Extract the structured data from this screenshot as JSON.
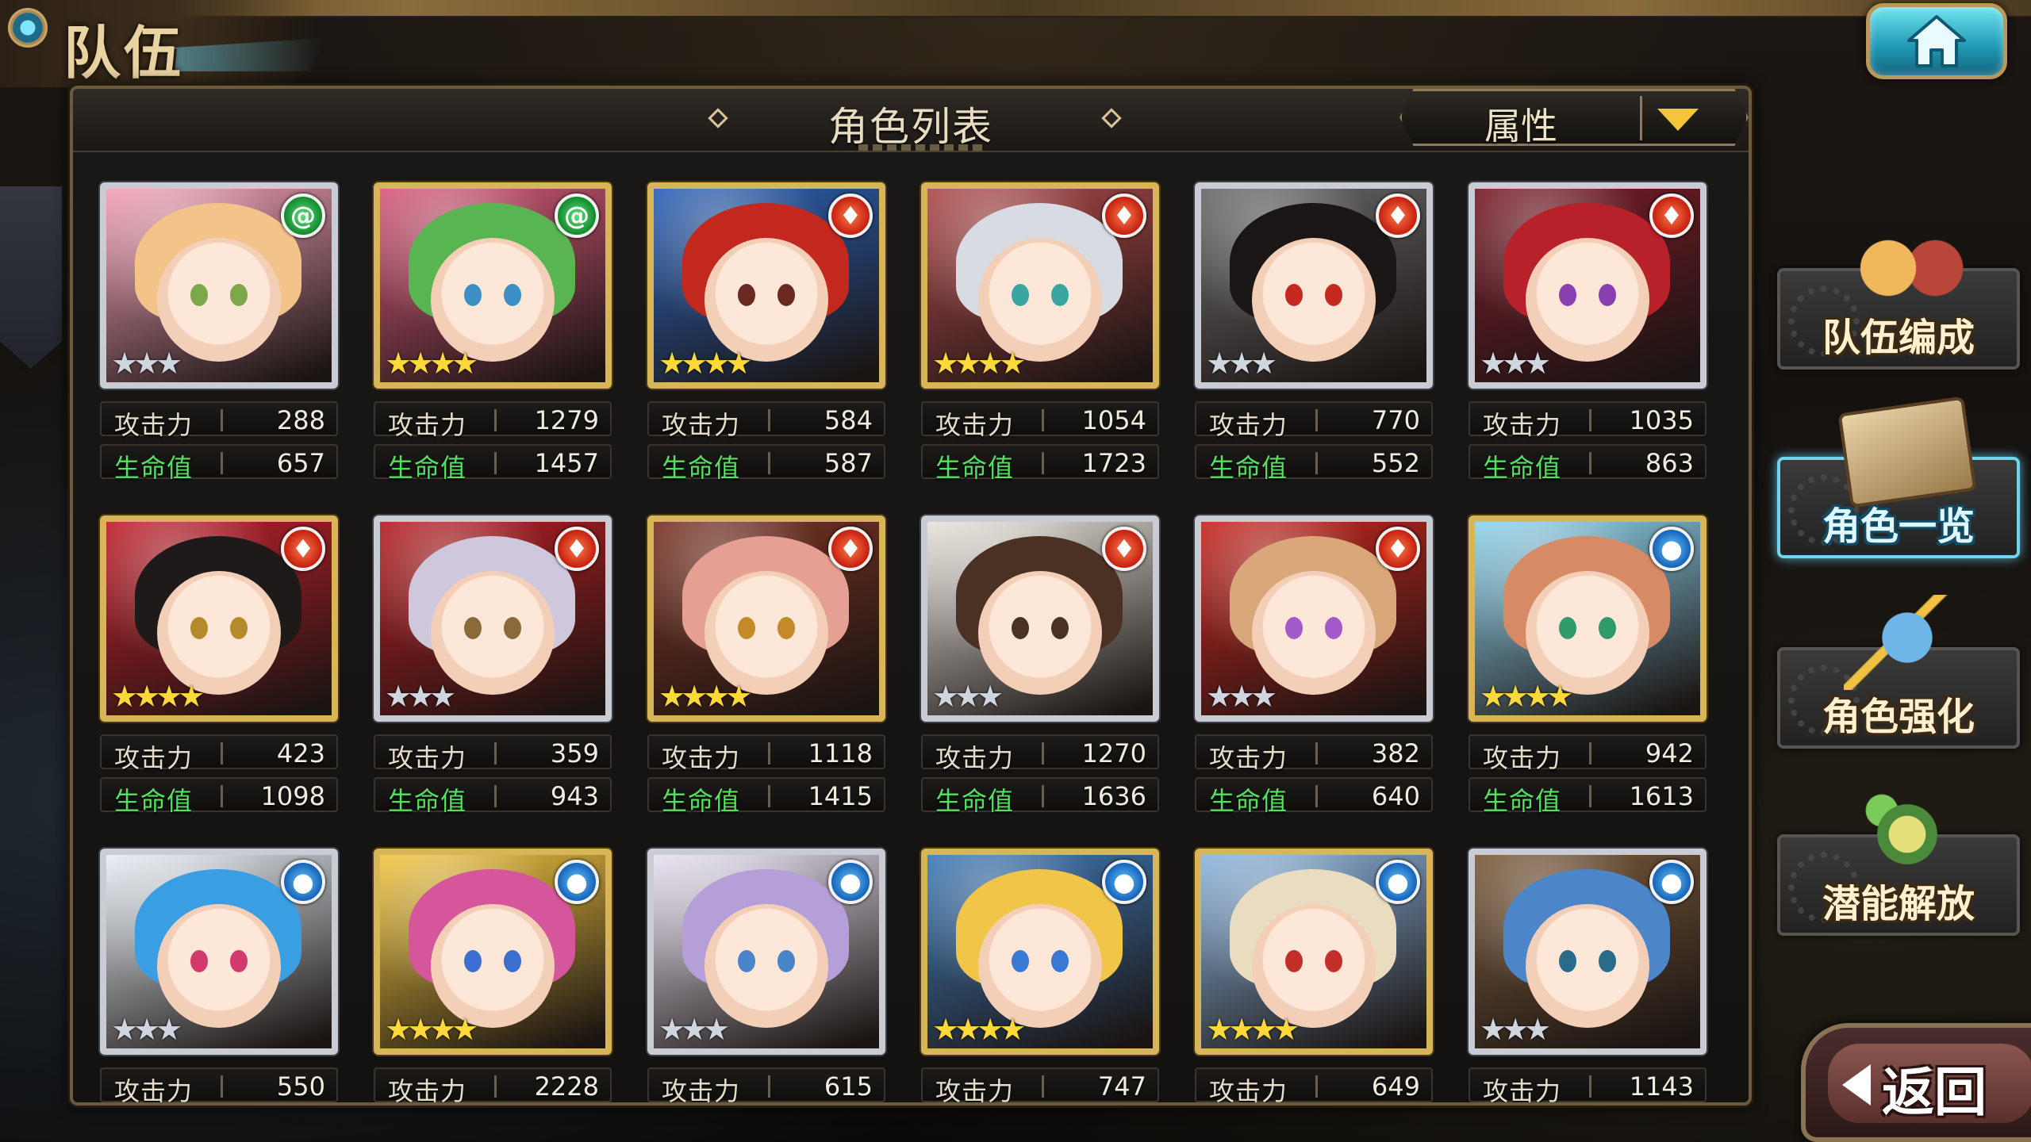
{
  "header": {
    "title": "队伍"
  },
  "panel": {
    "title": "角色列表",
    "sort_label": "属性"
  },
  "labels": {
    "atk": "攻击力",
    "hp": "生命值"
  },
  "colors": {
    "fire": "#d8321c",
    "wind": "#1fa63c",
    "water": "#1e7fd6",
    "gold_frame": "#d9b559",
    "silver_frame": "#c9cdd3",
    "hp_label": "#55e062"
  },
  "characters": [
    {
      "element": "wind",
      "element_icon": "wind-icon",
      "frame": "silver",
      "stars": 3,
      "atk": "288",
      "hp": "657",
      "hair": "#f3c38a",
      "eye": "#7aa84a",
      "accent": "#f3a1b7"
    },
    {
      "element": "wind",
      "element_icon": "wind-icon",
      "frame": "gold",
      "stars": 4,
      "atk": "1279",
      "hp": "1457",
      "hair": "#59b552",
      "eye": "#3c8fc5",
      "accent": "#d85a7a"
    },
    {
      "element": "fire",
      "element_icon": "fire-icon",
      "frame": "gold",
      "stars": 4,
      "atk": "584",
      "hp": "587",
      "hair": "#c2281d",
      "eye": "#6a2a22",
      "accent": "#2b62b8"
    },
    {
      "element": "fire",
      "element_icon": "fire-icon",
      "frame": "gold",
      "stars": 4,
      "atk": "1054",
      "hp": "1723",
      "hair": "#d9dbe3",
      "eye": "#3aa6a2",
      "accent": "#b04a4a"
    },
    {
      "element": "fire",
      "element_icon": "fire-icon",
      "frame": "silver",
      "stars": 3,
      "atk": "770",
      "hp": "552",
      "hair": "#1a1616",
      "eye": "#c4281f",
      "accent": "#6a6a6a"
    },
    {
      "element": "fire",
      "element_icon": "fire-icon",
      "frame": "silver",
      "stars": 3,
      "atk": "1035",
      "hp": "863",
      "hair": "#b8202a",
      "eye": "#8a3fb0",
      "accent": "#7a1b28"
    },
    {
      "element": "fire",
      "element_icon": "fire-icon",
      "frame": "gold",
      "stars": 4,
      "atk": "423",
      "hp": "1098",
      "hair": "#1f1a1a",
      "eye": "#b58a2a",
      "accent": "#c21f2a"
    },
    {
      "element": "fire",
      "element_icon": "fire-icon",
      "frame": "silver",
      "stars": 3,
      "atk": "359",
      "hp": "943",
      "hair": "#cfc8dc",
      "eye": "#8a6a3a",
      "accent": "#b81e22"
    },
    {
      "element": "fire",
      "element_icon": "fire-icon",
      "frame": "gold",
      "stars": 4,
      "atk": "1118",
      "hp": "1415",
      "hair": "#e6a093",
      "eye": "#c48a2a",
      "accent": "#7a3322"
    },
    {
      "element": "fire",
      "element_icon": "fire-icon",
      "frame": "silver",
      "stars": 3,
      "atk": "1270",
      "hp": "1636",
      "hair": "#4a3124",
      "eye": "#4a3124",
      "accent": "#e8e4dc"
    },
    {
      "element": "fire",
      "element_icon": "fire-icon",
      "frame": "silver",
      "stars": 3,
      "atk": "382",
      "hp": "640",
      "hair": "#d9a77a",
      "eye": "#a35ac8",
      "accent": "#c8261e"
    },
    {
      "element": "water",
      "element_icon": "water-icon",
      "frame": "gold",
      "stars": 4,
      "atk": "942",
      "hp": "1613",
      "hair": "#d78a66",
      "eye": "#2f9b6a",
      "accent": "#8fd4ee"
    },
    {
      "element": "water",
      "element_icon": "water-icon",
      "frame": "silver",
      "stars": 3,
      "atk": "550",
      "hp": "",
      "hair": "#3a9ee2",
      "eye": "#d13a6a",
      "accent": "#e7eef6"
    },
    {
      "element": "water",
      "element_icon": "water-icon",
      "frame": "gold",
      "stars": 4,
      "atk": "2228",
      "hp": "",
      "hair": "#d5569a",
      "eye": "#3a6fd0",
      "accent": "#f3c642"
    },
    {
      "element": "water",
      "element_icon": "water-icon",
      "frame": "silver",
      "stars": 3,
      "atk": "615",
      "hp": "",
      "hair": "#b59fd8",
      "eye": "#4a84c8",
      "accent": "#e8e2f2"
    },
    {
      "element": "water",
      "element_icon": "water-icon",
      "frame": "gold",
      "stars": 4,
      "atk": "747",
      "hp": "",
      "hair": "#f0c548",
      "eye": "#3a7ad4",
      "accent": "#3f7ab8"
    },
    {
      "element": "water",
      "element_icon": "water-icon",
      "frame": "gold",
      "stars": 4,
      "atk": "649",
      "hp": "",
      "hair": "#eadcc0",
      "eye": "#c22f2a",
      "accent": "#8db6e0"
    },
    {
      "element": "water",
      "element_icon": "water-icon",
      "frame": "silver",
      "stars": 3,
      "atk": "1143",
      "hp": "",
      "hair": "#4d86c8",
      "eye": "#2a6a8a",
      "accent": "#7a5a3a"
    }
  ],
  "side_menu": [
    {
      "label": "队伍编成",
      "icon": "team-chars-icon",
      "active": false
    },
    {
      "label": "角色一览",
      "icon": "book-icon",
      "active": true
    },
    {
      "label": "角色强化",
      "icon": "upgrade-card-icon",
      "active": false
    },
    {
      "label": "潜能解放",
      "icon": "potential-orb-icon",
      "active": false
    }
  ],
  "back": {
    "label": "返回"
  }
}
